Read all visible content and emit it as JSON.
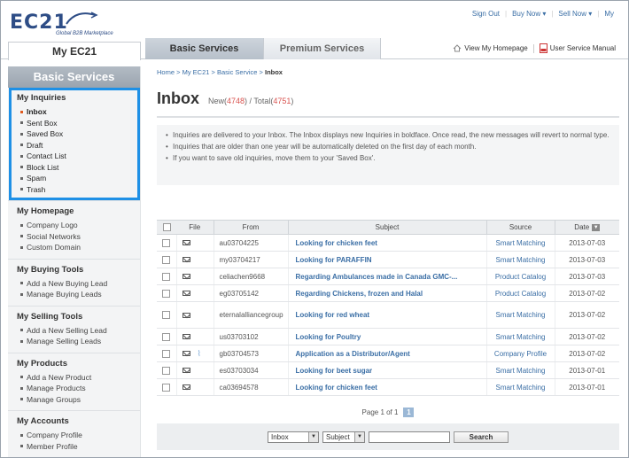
{
  "header": {
    "logo_text": "EC21",
    "logo_tagline": "Global B2B Marketplace",
    "nav": [
      "Sign Out",
      "Buy Now",
      "Sell Now",
      "My"
    ]
  },
  "tabs": {
    "my_ec21": "My EC21",
    "basic": "Basic Services",
    "premium": "Premium Services",
    "links": [
      "View My Homepage",
      "User Service Manual"
    ]
  },
  "sidebar": {
    "title": "Basic Services",
    "groups": [
      {
        "title": "My Inquiries",
        "items": [
          "Inbox",
          "Sent Box",
          "Saved Box",
          "Draft",
          "Contact List",
          "Block List",
          "Spam",
          "Trash"
        ]
      },
      {
        "title": "My Homepage",
        "items": [
          "Company Logo",
          "Social Networks",
          "Custom Domain"
        ]
      },
      {
        "title": "My Buying Tools",
        "items": [
          "Add a New Buying Lead",
          "Manage Buying Leads"
        ]
      },
      {
        "title": "My Selling Tools",
        "items": [
          "Add a New Selling Lead",
          "Manage Selling Leads"
        ]
      },
      {
        "title": "My Products",
        "items": [
          "Add a New Product",
          "Manage Products",
          "Manage Groups"
        ]
      },
      {
        "title": "My Accounts",
        "items": [
          "Company Profile",
          "Member Profile"
        ]
      }
    ]
  },
  "breadcrumb": {
    "home": "Home",
    "sep": " > ",
    "l1": "My EC21",
    "l2": "Basic Service",
    "current": "Inbox"
  },
  "page": {
    "title": "Inbox",
    "new_label": "New(",
    "new_count": "4748",
    "total_label": ") / Total(",
    "total_count": "4751",
    "close": ")"
  },
  "notice": [
    "Inquiries are delivered to your Inbox. The Inbox displays new Inquiries in boldface. Once read, the new messages will revert to normal type.",
    "Inquiries that are older than one year will be automatically deleted on the first day of each month.",
    "If you want to save old inquiries, move them to your 'Saved Box'."
  ],
  "table": {
    "headers": {
      "file": "File",
      "from": "From",
      "subject": "Subject",
      "source": "Source",
      "date": "Date"
    },
    "rows": [
      {
        "from": "au03704225",
        "subject": "Looking for chicken feet",
        "source": "Smart Matching",
        "date": "2013-07-03",
        "attach": false
      },
      {
        "from": "my03704217",
        "subject": "Looking for PARAFFIN",
        "source": "Smart Matching",
        "date": "2013-07-03",
        "attach": false
      },
      {
        "from": "celiachen9668",
        "subject": "Regarding Ambulances made in Canada GMC-...",
        "source": "Product Catalog",
        "date": "2013-07-03",
        "attach": false
      },
      {
        "from": "eg03705142",
        "subject": "Regarding Chickens, frozen and Halal",
        "source": "Product Catalog",
        "date": "2013-07-02",
        "attach": false
      },
      {
        "from": "eternalalliancegroup",
        "subject": "Looking for red wheat",
        "source": "Smart Matching",
        "date": "2013-07-02",
        "attach": false
      },
      {
        "from": "us03703102",
        "subject": "Looking for Poultry",
        "source": "Smart Matching",
        "date": "2013-07-02",
        "attach": false
      },
      {
        "from": "gb03704573",
        "subject": "Application as a Distributor/Agent",
        "source": "Company Profile",
        "date": "2013-07-02",
        "attach": true
      },
      {
        "from": "es03703034",
        "subject": "Looking for beet sugar",
        "source": "Smart Matching",
        "date": "2013-07-01",
        "attach": false
      },
      {
        "from": "ca03694578",
        "subject": "Looking for chicken feet",
        "source": "Smart Matching",
        "date": "2013-07-01",
        "attach": false
      }
    ]
  },
  "pager": {
    "text": "Page 1 of 1",
    "current": "1"
  },
  "search": {
    "box_select": "Inbox",
    "field_select": "Subject",
    "query": "",
    "button": "Search"
  },
  "colors": {
    "accent": "#3a6ea5",
    "highlight": "#1e90e6",
    "active": "#e05a1e",
    "count": "#d9534f"
  }
}
